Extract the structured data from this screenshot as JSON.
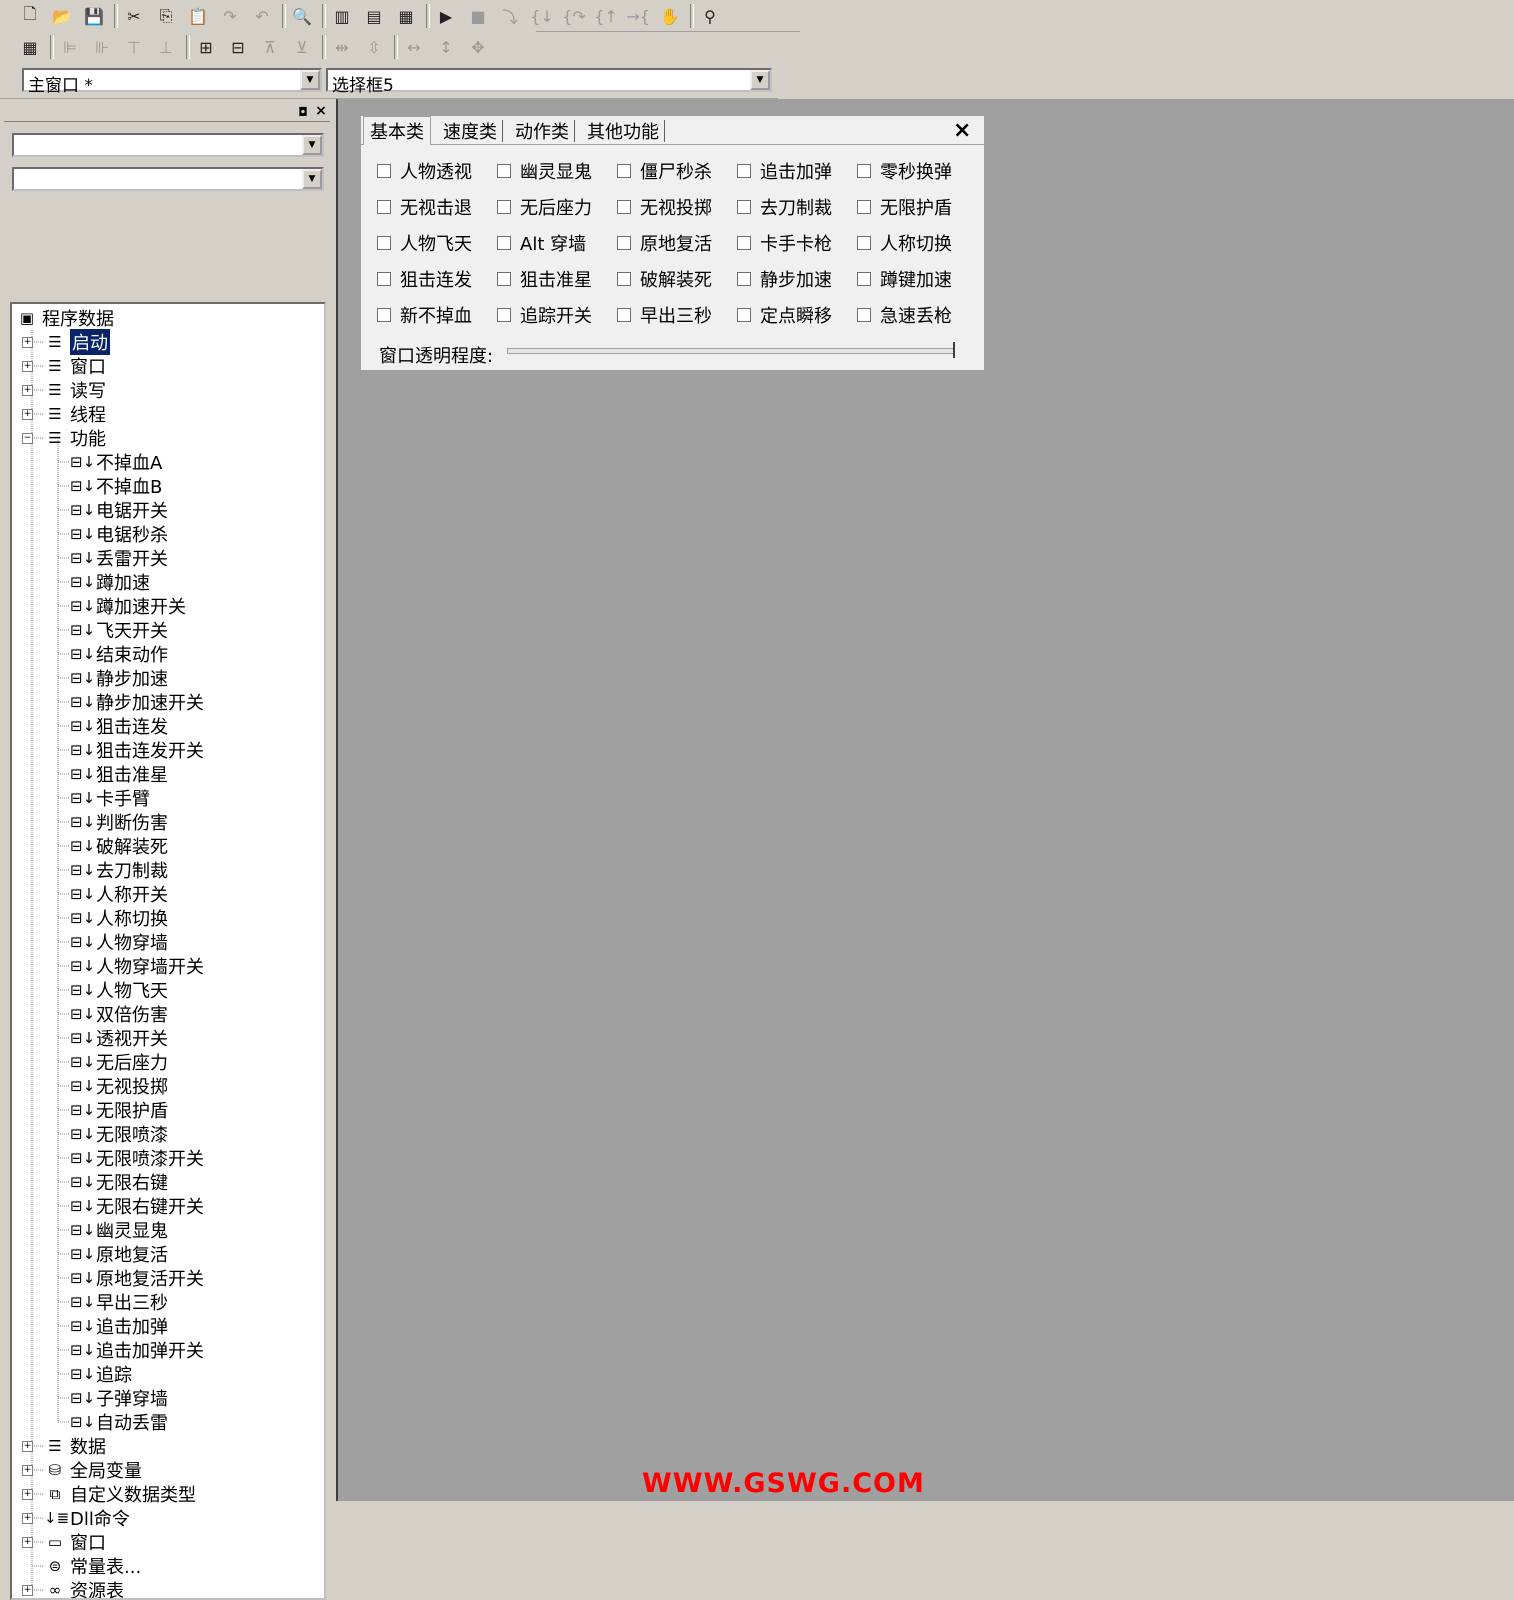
{
  "top_combos": {
    "window_value": "主窗口 *",
    "control_value": "选择框5"
  },
  "toolbar1_icons": [
    "new-file-icon",
    "open-folder-icon",
    "save-icon",
    "cut-icon",
    "copy-icon",
    "paste-icon",
    "redo-icon",
    "undo-icon",
    "find-icon",
    "layout-1-icon",
    "layout-2-icon",
    "layout-3-icon",
    "run-icon",
    "stop-icon",
    "step-icon",
    "step-into-icon",
    "step-over-icon",
    "step-out-icon",
    "run-to-cursor-icon",
    "hand-icon",
    "spy-icon"
  ],
  "toolbar2_icons": [
    "calculator-icon",
    "align-left-icon",
    "align-right-icon",
    "align-top-icon",
    "align-bottom-icon",
    "center-horizontal-icon",
    "center-vertical-icon",
    "space-horizontal-icon",
    "space-vertical-icon",
    "distribute-horizontal-icon",
    "distribute-vertical-icon",
    "same-width-icon",
    "same-height-icon",
    "same-size-icon"
  ],
  "tree": {
    "root": "程序数据",
    "top_nodes": [
      {
        "label": "启动",
        "icon": "module-icon",
        "expander": "+",
        "selected": true
      },
      {
        "label": "窗口",
        "icon": "module-icon",
        "expander": "+"
      },
      {
        "label": "读写",
        "icon": "module-icon",
        "expander": "+"
      },
      {
        "label": "线程",
        "icon": "module-icon",
        "expander": "+"
      },
      {
        "label": "功能",
        "icon": "module-icon",
        "expander": "-"
      }
    ],
    "functions": [
      "不掉血A",
      "不掉血B",
      "电锯开关",
      "电锯秒杀",
      "丢雷开关",
      "蹲加速",
      "蹲加速开关",
      "飞天开关",
      "结束动作",
      "静步加速",
      "静步加速开关",
      "狙击连发",
      "狙击连发开关",
      "狙击准星",
      "卡手臂",
      "判断伤害",
      "破解装死",
      "去刀制裁",
      "人称开关",
      "人称切换",
      "人物穿墙",
      "人物穿墙开关",
      "人物飞天",
      "双倍伤害",
      "透视开关",
      "无后座力",
      "无视投掷",
      "无限护盾",
      "无限喷漆",
      "无限喷漆开关",
      "无限右键",
      "无限右键开关",
      "幽灵显鬼",
      "原地复活",
      "原地复活开关",
      "早出三秒",
      "追击加弹",
      "追击加弹开关",
      "追踪",
      "子弹穿墙",
      "自动丢雷"
    ],
    "bottom_nodes": [
      {
        "label": "数据",
        "icon": "module-icon",
        "expander": "+"
      },
      {
        "label": "全局变量",
        "icon": "database-icon",
        "expander": "+"
      },
      {
        "label": "自定义数据类型",
        "icon": "data-type-icon",
        "expander": "+"
      },
      {
        "label": "Dll命令",
        "icon": "dll-icon",
        "expander": "+"
      },
      {
        "label": "窗口",
        "icon": "window-icon",
        "expander": "+"
      },
      {
        "label": "常量表...",
        "icon": "constants-icon",
        "expander": ""
      },
      {
        "label": "资源表",
        "icon": "resources-icon",
        "expander": "+"
      }
    ]
  },
  "dialog": {
    "tabs": [
      "基本类",
      "速度类",
      "动作类",
      "其他功能"
    ],
    "active_tab": 0,
    "close": "×",
    "checkboxes": [
      [
        "人物透视",
        "幽灵显鬼",
        "僵尸秒杀",
        "追击加弹",
        "零秒换弹"
      ],
      [
        "无视击退",
        "无后座力",
        "无视投掷",
        "去刀制裁",
        "无限护盾"
      ],
      [
        "人物飞天",
        "Alt 穿墙",
        "原地复活",
        "卡手卡枪",
        "人称切换"
      ],
      [
        "狙击连发",
        "狙击准星",
        "破解装死",
        "静步加速",
        "蹲键加速"
      ],
      [
        "新不掉血",
        "追踪开关",
        "早出三秒",
        "定点瞬移",
        "急速丢枪"
      ]
    ],
    "slider_label": "窗口透明程度:",
    "slider_value": 1.0
  },
  "watermark": "WWW.GSWG.COM"
}
